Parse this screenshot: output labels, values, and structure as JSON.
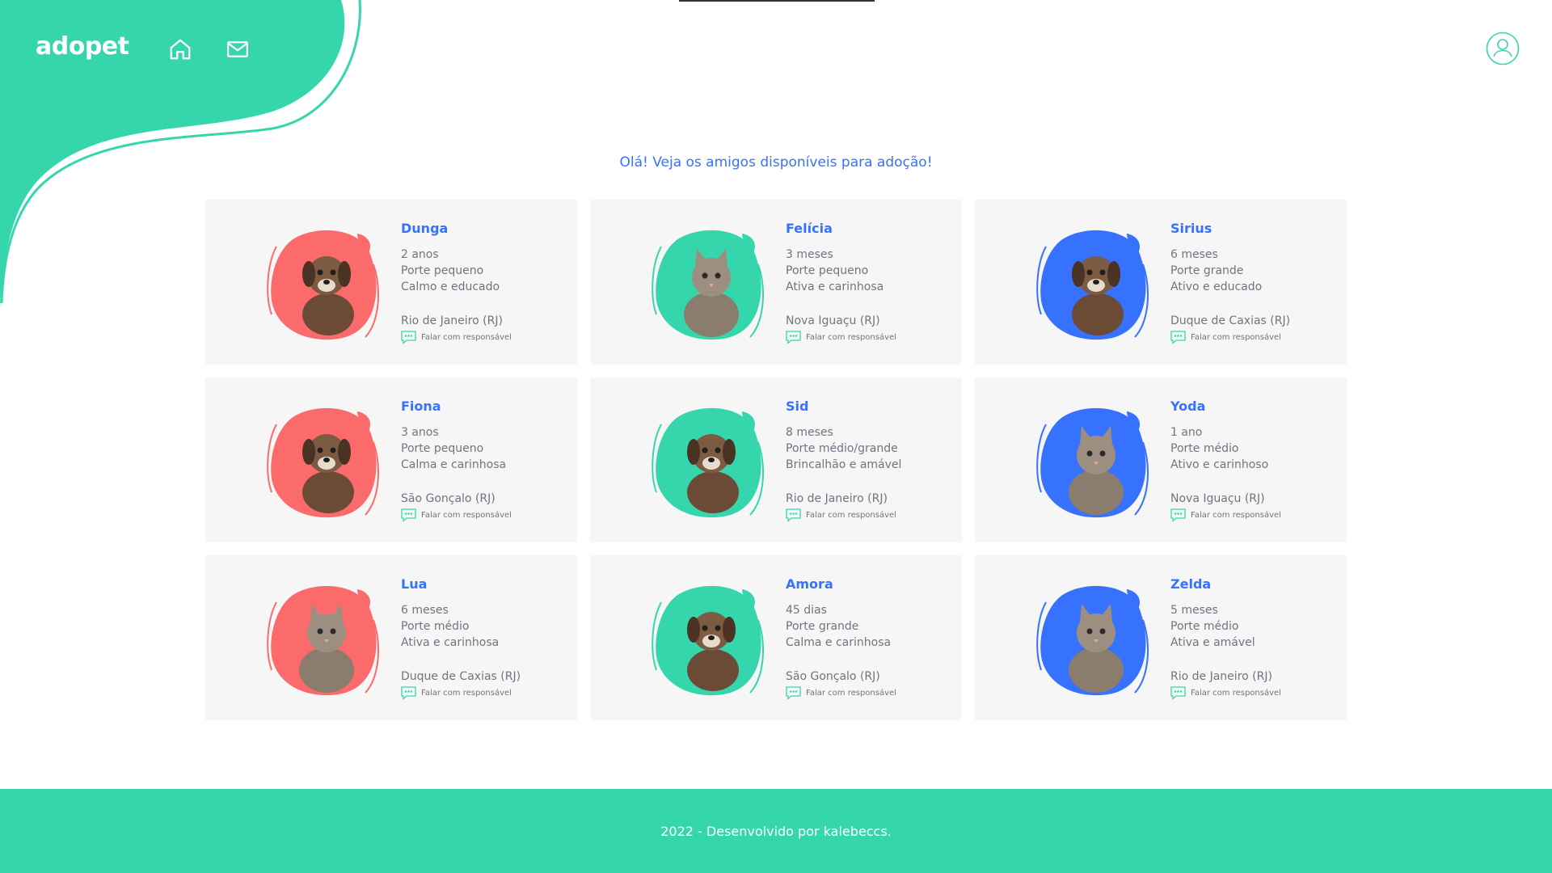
{
  "header": {
    "logo": "adopet",
    "nav": [
      {
        "icon": "home-icon",
        "label": "Home"
      },
      {
        "icon": "mail-icon",
        "label": "Mensagens"
      }
    ],
    "profile_icon": "user-icon"
  },
  "main": {
    "headline": "Olá! Veja os amigos disponíveis para adoção!",
    "pets": [
      {
        "name": "Dunga",
        "age": "2 anos",
        "size": "Porte pequeno",
        "temper": "Calmo e educado",
        "city": "Rio de Janeiro (RJ)",
        "contact": "Falar com responsável",
        "blob_color": "#fc6b6b",
        "species": "dog"
      },
      {
        "name": "Felícia",
        "age": "3 meses",
        "size": "Porte pequeno",
        "temper": "Ativa e carinhosa",
        "city": "Nova Iguaçu (RJ)",
        "contact": "Falar com responsável",
        "blob_color": "#36d6ad",
        "species": "cat"
      },
      {
        "name": "Sirius",
        "age": "6 meses",
        "size": "Porte grande",
        "temper": "Ativo e educado",
        "city": "Duque de Caxias (RJ)",
        "contact": "Falar com responsável",
        "blob_color": "#3772ff",
        "species": "dog"
      },
      {
        "name": "Fiona",
        "age": "3 anos",
        "size": "Porte pequeno",
        "temper": "Calma e carinhosa",
        "city": "São Gonçalo (RJ)",
        "contact": "Falar com responsável",
        "blob_color": "#fc6b6b",
        "species": "dog"
      },
      {
        "name": "Sid",
        "age": "8 meses",
        "size": "Porte médio/grande",
        "temper": "Brincalhão e amável",
        "city": "Rio de Janeiro (RJ)",
        "contact": "Falar com responsável",
        "blob_color": "#36d6ad",
        "species": "dog"
      },
      {
        "name": "Yoda",
        "age": "1 ano",
        "size": "Porte médio",
        "temper": "Ativo e carinhoso",
        "city": "Nova Iguaçu (RJ)",
        "contact": "Falar com responsável",
        "blob_color": "#3772ff",
        "species": "cat"
      },
      {
        "name": "Lua",
        "age": "6 meses",
        "size": "Porte médio",
        "temper": "Ativa e carinhosa",
        "city": "Duque de Caxias (RJ)",
        "contact": "Falar com responsável",
        "blob_color": "#fc6b6b",
        "species": "cat"
      },
      {
        "name": "Amora",
        "age": "45 dias",
        "size": "Porte grande",
        "temper": "Calma e carinhosa",
        "city": "São Gonçalo (RJ)",
        "contact": "Falar com responsável",
        "blob_color": "#36d6ad",
        "species": "dog"
      },
      {
        "name": "Zelda",
        "age": "5 meses",
        "size": "Porte médio",
        "temper": "Ativa e amável",
        "city": "Rio de Janeiro (RJ)",
        "contact": "Falar com responsável",
        "blob_color": "#3772ff",
        "species": "cat"
      }
    ]
  },
  "footer": {
    "text": "2022 - Desenvolvido por kalebeccs."
  },
  "colors": {
    "accent": "#36d6ad",
    "primary_text": "#3772ff",
    "body_text": "#737380",
    "card_bg": "#f6f6f6"
  }
}
